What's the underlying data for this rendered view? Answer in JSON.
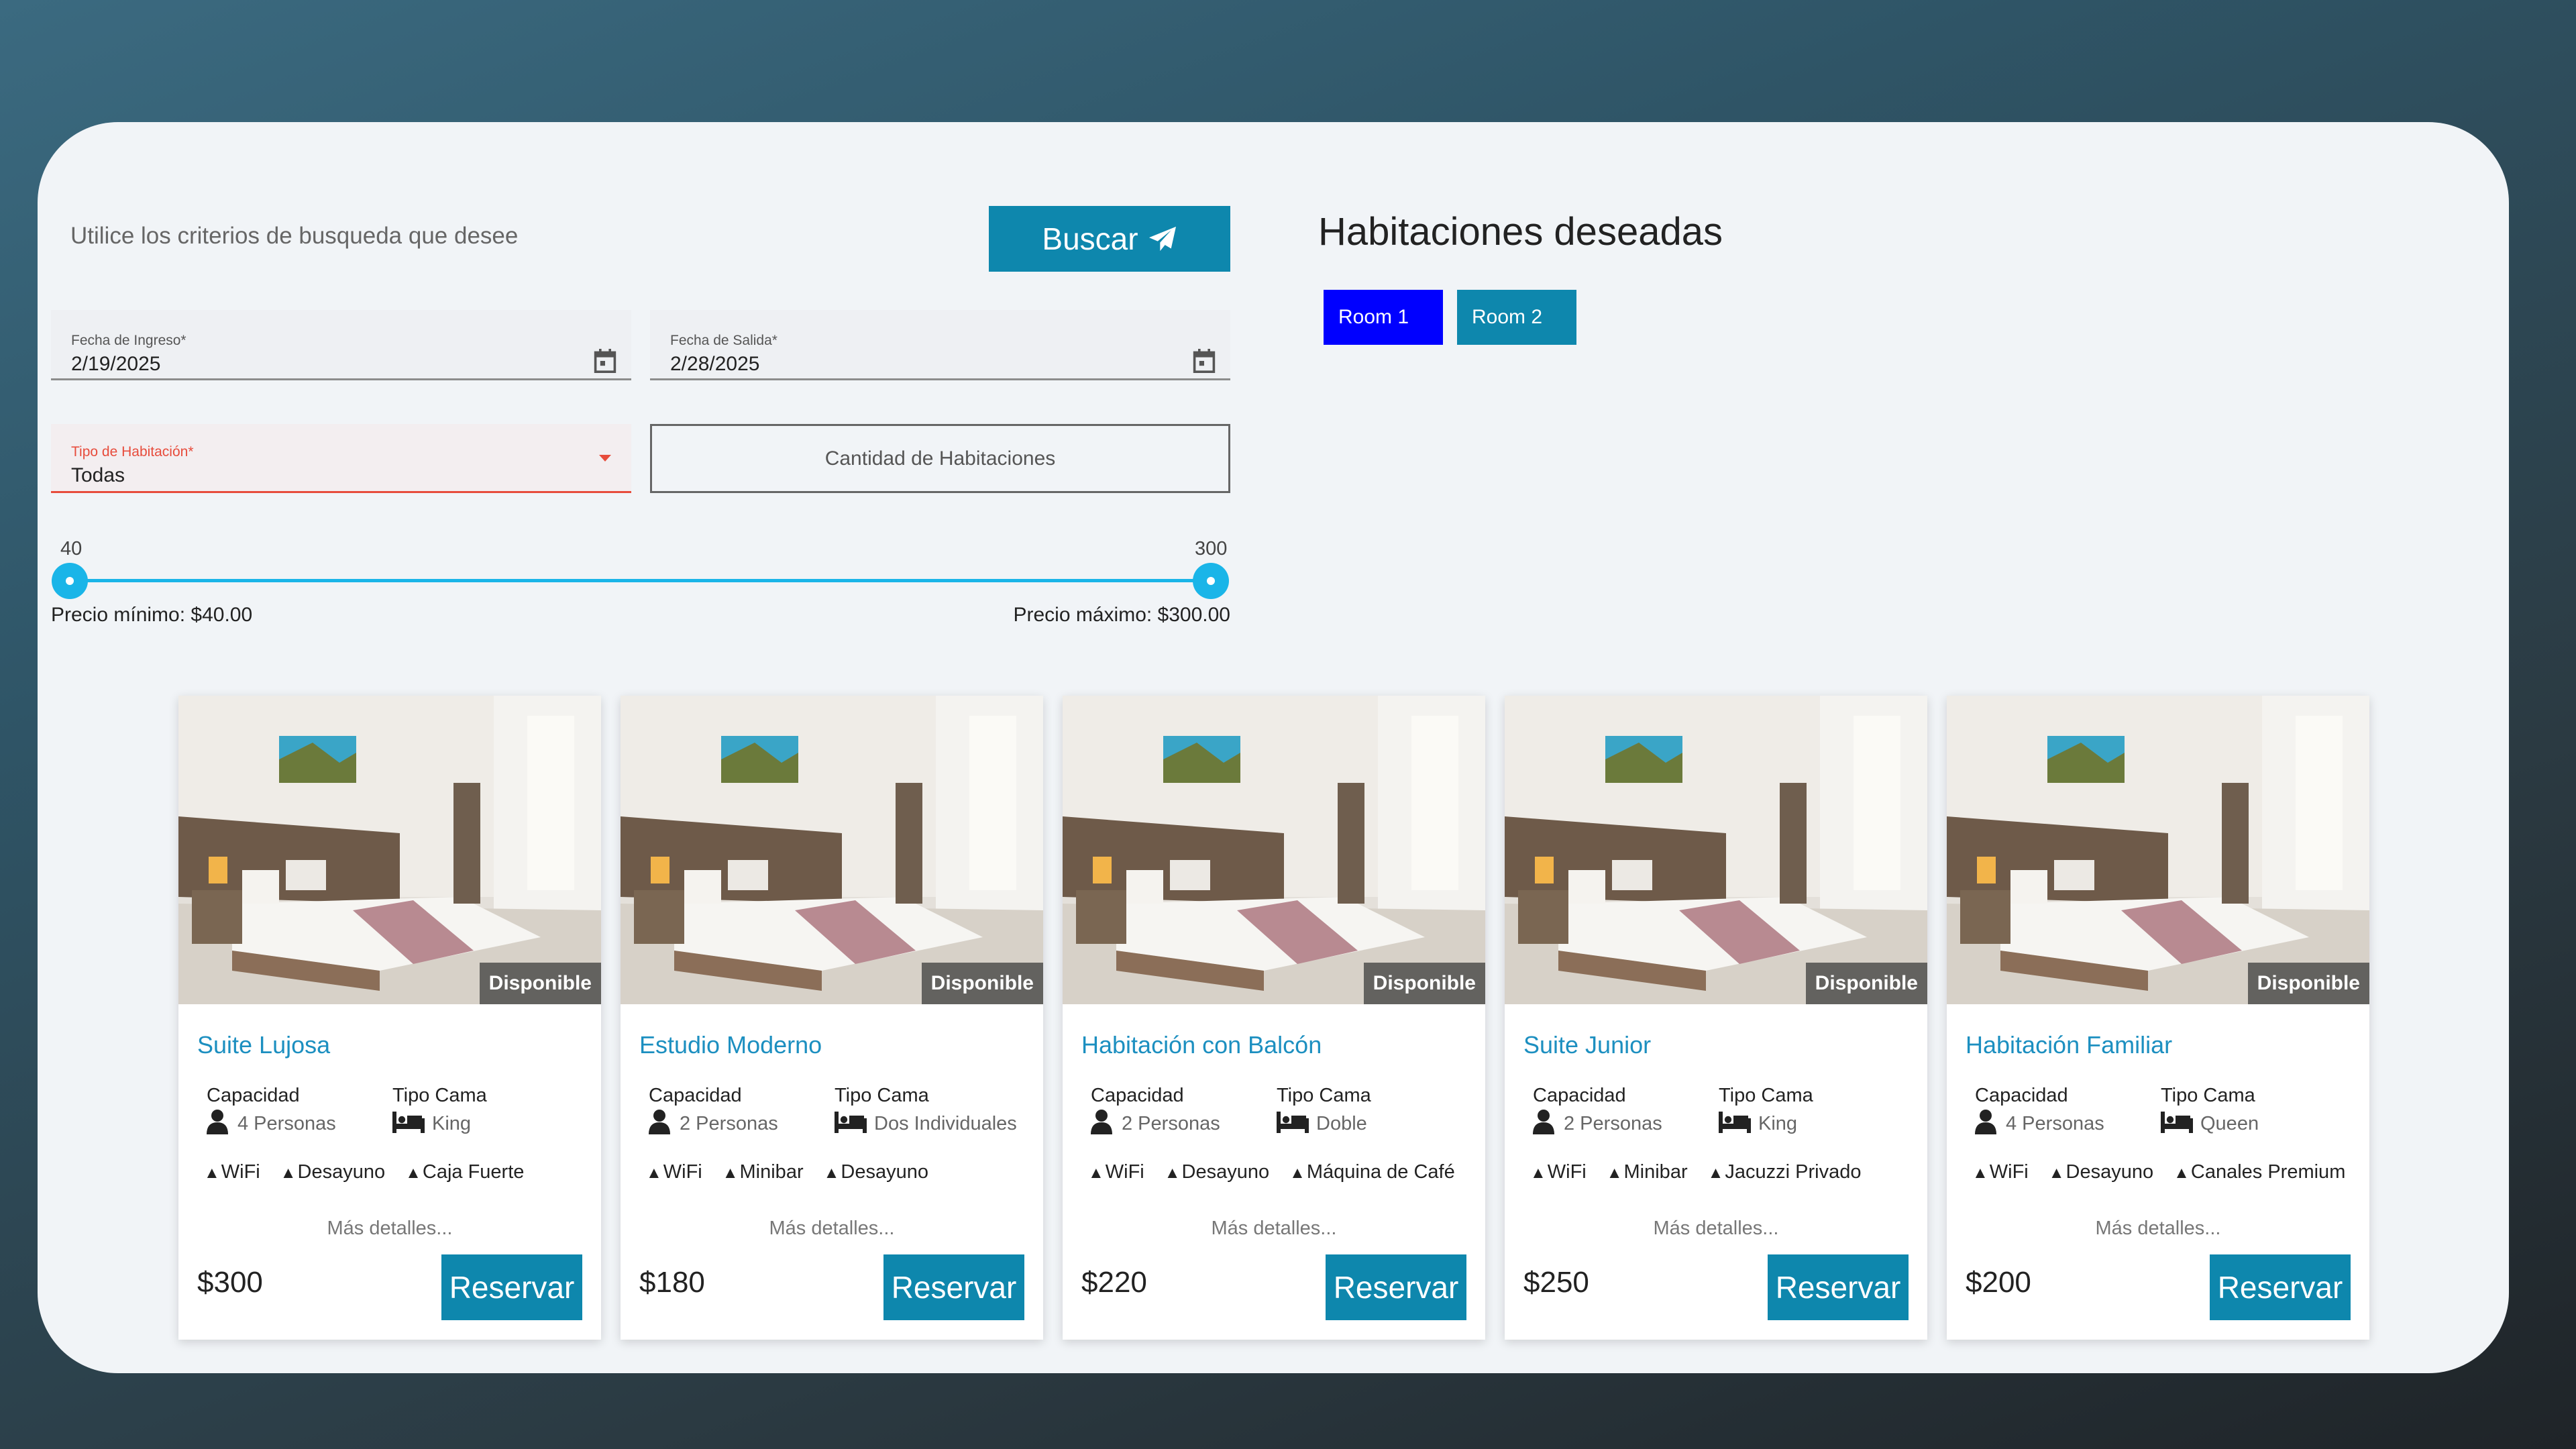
{
  "search": {
    "hint": "Utilice los criterios de busqueda que desee",
    "button_label": "Buscar",
    "checkin": {
      "label": "Fecha de Ingreso*",
      "value": "2/19/2025"
    },
    "checkout": {
      "label": "Fecha de Salida*",
      "value": "2/28/2025"
    },
    "room_type": {
      "label": "Tipo de Habitación*",
      "value": "Todas"
    },
    "quantity_placeholder": "Cantidad de Habitaciones",
    "price_slider": {
      "min_value": "40",
      "max_value": "300",
      "min_text": "Precio mínimo: $40.00",
      "max_text": "Precio máximo: $300.00"
    }
  },
  "wanted": {
    "title": "Habitaciones deseadas",
    "rooms": [
      {
        "label": "Room 1",
        "color": "#0000ff"
      },
      {
        "label": "Room 2",
        "color": "#0e87ad"
      }
    ]
  },
  "cards": [
    {
      "title": "Suite Lujosa",
      "status": "Disponible",
      "capacity_label": "Capacidad",
      "capacity": "4 Personas",
      "bed_label": "Tipo Cama",
      "bed": "King",
      "amenities": [
        "WiFi",
        "Desayuno",
        "Caja Fuerte"
      ],
      "more": "Más detalles...",
      "price": "$300",
      "button": "Reservar"
    },
    {
      "title": "Estudio Moderno",
      "status": "Disponible",
      "capacity_label": "Capacidad",
      "capacity": "2 Personas",
      "bed_label": "Tipo Cama",
      "bed": "Dos Individuales",
      "amenities": [
        "WiFi",
        "Minibar",
        "Desayuno"
      ],
      "more": "Más detalles...",
      "price": "$180",
      "button": "Reservar"
    },
    {
      "title": "Habitación con Balcón",
      "status": "Disponible",
      "capacity_label": "Capacidad",
      "capacity": "2 Personas",
      "bed_label": "Tipo Cama",
      "bed": "Doble",
      "amenities": [
        "WiFi",
        "Desayuno",
        "Máquina de Café"
      ],
      "more": "Más detalles...",
      "price": "$220",
      "button": "Reservar"
    },
    {
      "title": "Suite Junior",
      "status": "Disponible",
      "capacity_label": "Capacidad",
      "capacity": "2 Personas",
      "bed_label": "Tipo Cama",
      "bed": "King",
      "amenities": [
        "WiFi",
        "Minibar",
        "Jacuzzi Privado"
      ],
      "more": "Más detalles...",
      "price": "$250",
      "button": "Reservar"
    },
    {
      "title": "Habitación Familiar",
      "status": "Disponible",
      "capacity_label": "Capacidad",
      "capacity": "4 Personas",
      "bed_label": "Tipo Cama",
      "bed": "Queen",
      "amenities": [
        "WiFi",
        "Desayuno",
        "Canales Premium"
      ],
      "more": "Más detalles...",
      "price": "$200",
      "button": "Reservar"
    }
  ],
  "colors": {
    "accent": "#0e87ad",
    "title_link": "#1c8fc0",
    "slider": "#1ab5e8",
    "error": "#e74c3c"
  }
}
